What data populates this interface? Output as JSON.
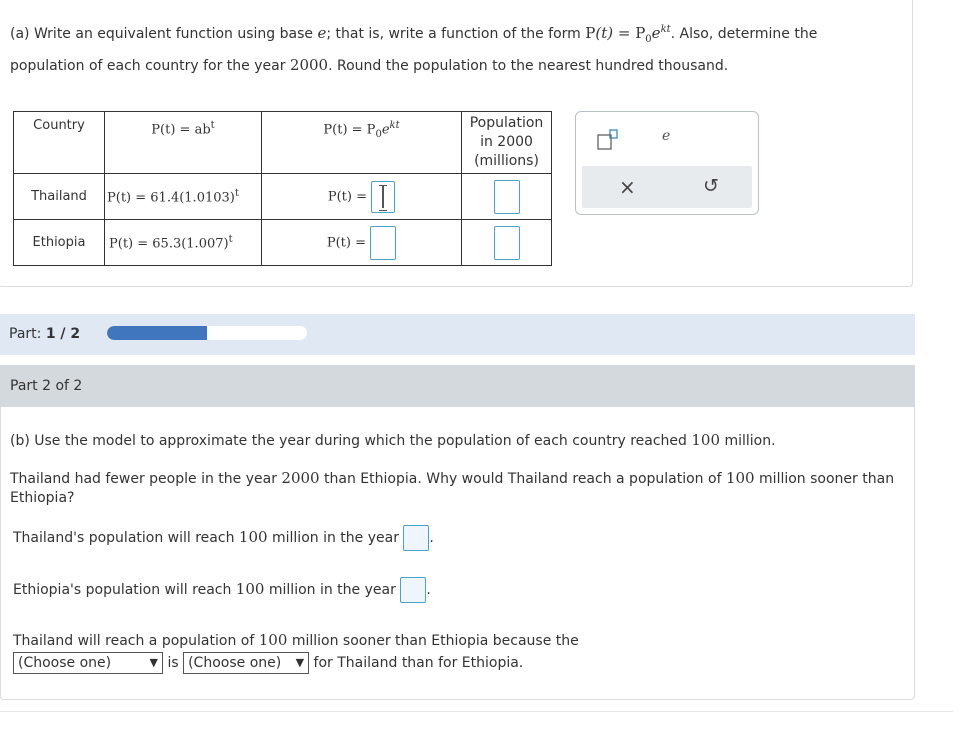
{
  "part_a": {
    "line1_prefix": "(a) Write an equivalent function using base ",
    "line1_e": "e",
    "line1_mid": "; that is, write a function of the form ",
    "line1_suffix": ". Also, determine the",
    "line2_prefix": "population of each country for the year ",
    "line2_year": "2000",
    "line2_suffix": ". Round the population to the nearest hundred thousand."
  },
  "table": {
    "headers": {
      "country": "Country",
      "col_ab": "P(t) = ab",
      "col_ab_exp": "t",
      "col_pe": "P(t) = P",
      "col_pe_sub": "0",
      "col_pe_e": "e",
      "col_pe_exp": "kt",
      "population_line1": "Population",
      "population_line2": "in 2000",
      "population_line3": "(millions)"
    },
    "rows": [
      {
        "country": "Thailand",
        "formula": "P(t) = 61.4(1.0103)",
        "exp": "t",
        "pe_label": "P(t) ="
      },
      {
        "country": "Ethiopia",
        "formula": "P(t) = 65.3(1.007)",
        "exp": "t",
        "pe_label": "P(t) ="
      }
    ]
  },
  "toolbar": {
    "superscript_icon": "superscript-box-icon",
    "e_label": "e",
    "clear_icon": "×",
    "undo_icon": "↺"
  },
  "progress": {
    "label_prefix": "Part: ",
    "label_value": "1 / 2",
    "fraction": 0.5
  },
  "part2": {
    "header": "Part 2 of 2",
    "question_b_prefix": "(b) Use the model to approximate the year during which the population of each country reached ",
    "question_b_num": "100",
    "question_b_suffix": " million.",
    "why_line1_prefix": "Thailand had fewer people in the year ",
    "why_year": "2000",
    "why_line1_suffix": " than Ethiopia. Why would Thailand reach a population of ",
    "why_num": "100",
    "why_line1_end": " million sooner than",
    "why_line2": "Ethiopia?",
    "thailand_prefix": "Thailand's population will reach ",
    "thailand_num": "100",
    "thailand_suffix": " million in the year",
    "ethiopia_prefix": "Ethiopia's population will reach ",
    "ethiopia_num": "100",
    "ethiopia_suffix": " million in the year",
    "reason_prefix": "Thailand will reach a population of ",
    "reason_num": "100",
    "reason_suffix": " million sooner than Ethiopia because the",
    "select1": "(Choose one)",
    "is_word": "is",
    "select2": "(Choose one)",
    "reason_end": "for Thailand than for Ethiopia.",
    "period": "."
  }
}
